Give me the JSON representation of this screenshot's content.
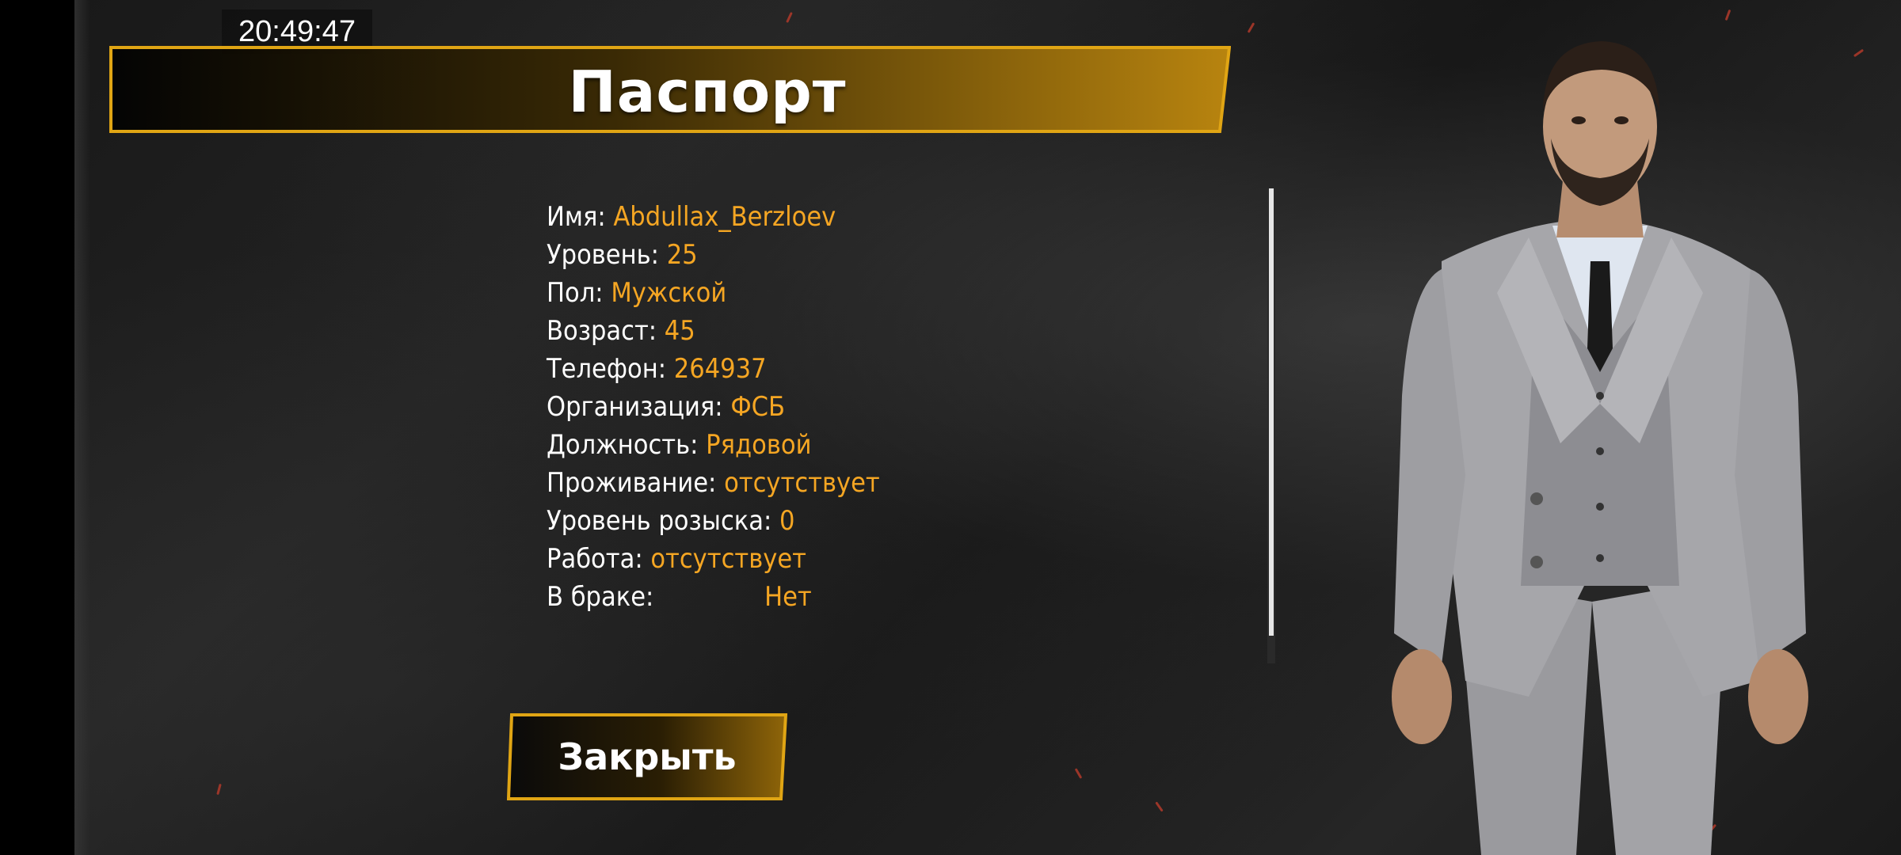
{
  "clock": "20:49:47",
  "title": "Паспорт",
  "fields": [
    {
      "label": "Имя:",
      "value": "Abdullax_Berzloev"
    },
    {
      "label": "Уровень:",
      "value": "25"
    },
    {
      "label": "Пол:",
      "value": "Мужской"
    },
    {
      "label": "Возраст:",
      "value": "45"
    },
    {
      "label": "Телефон:",
      "value": "264937"
    },
    {
      "label": "Организация:",
      "value": "ФСБ"
    },
    {
      "label": "Должность:",
      "value": "Рядовой"
    },
    {
      "label": "Проживание:",
      "value": "отсутствует"
    },
    {
      "label": "Уровень розыска:",
      "value": "0"
    },
    {
      "label": "Работа:",
      "value": "отсутствует"
    },
    {
      "label": "В браке:",
      "value": "Нет"
    }
  ],
  "close_button": "Закрыть",
  "colors": {
    "accent": "#f5a623",
    "banner_gold": "#a77810",
    "banner_border": "#e0a514",
    "background": "#1c1c1c"
  },
  "icons": {
    "character": "character-model-in-grey-suit"
  }
}
